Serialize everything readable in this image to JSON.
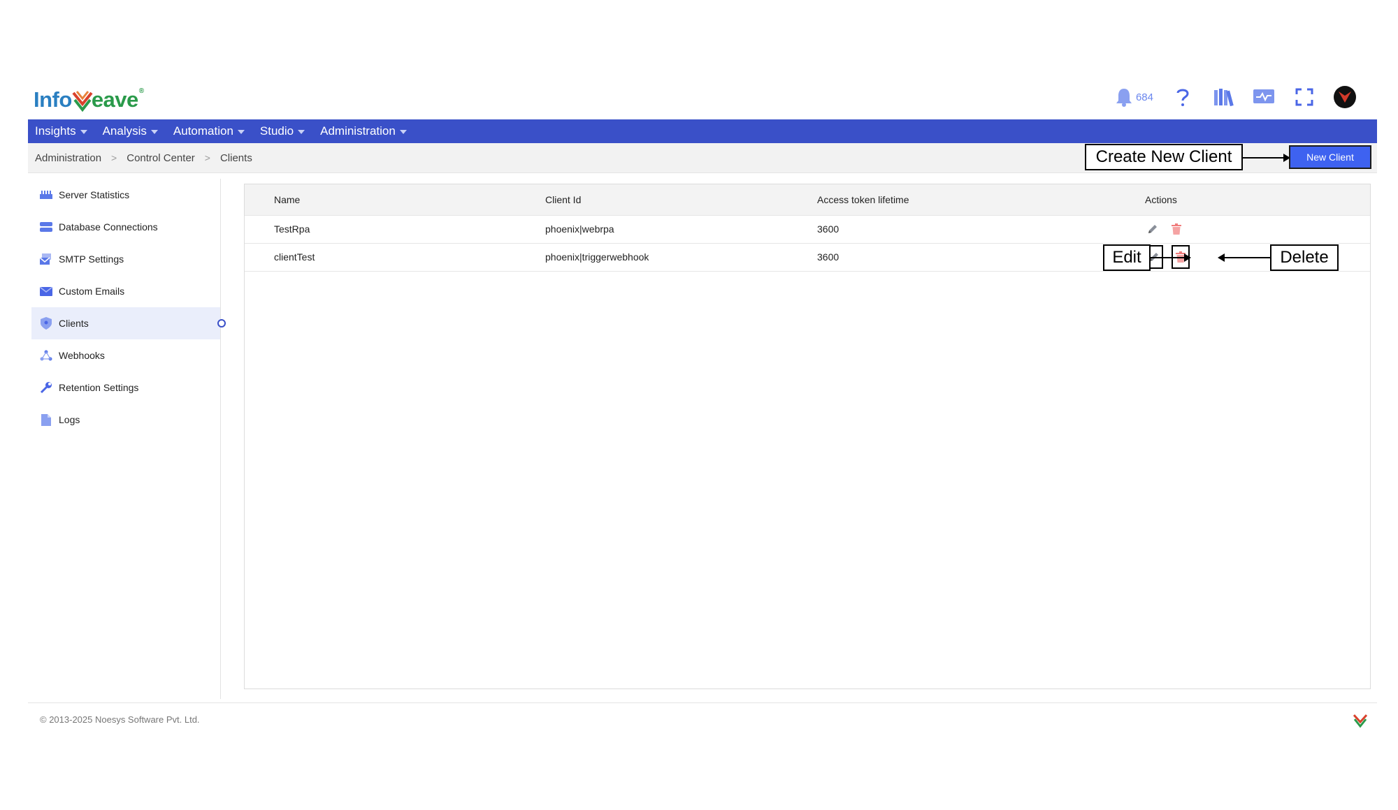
{
  "brand": {
    "logo_text_left": "Info",
    "logo_text_right": "eave",
    "logo_reg": "®"
  },
  "header": {
    "notification_count": "684"
  },
  "menu": [
    {
      "label": "Insights"
    },
    {
      "label": "Analysis"
    },
    {
      "label": "Automation"
    },
    {
      "label": "Studio"
    },
    {
      "label": "Administration"
    }
  ],
  "breadcrumb": [
    "Administration",
    "Control Center",
    "Clients"
  ],
  "new_client_button": "New Client",
  "annotations": {
    "create": "Create New Client",
    "edit": "Edit",
    "delete": "Delete"
  },
  "sidebar": {
    "items": [
      {
        "label": "Server Statistics",
        "icon": "server-icon"
      },
      {
        "label": "Database Connections",
        "icon": "database-icon"
      },
      {
        "label": "SMTP Settings",
        "icon": "mail-settings-icon"
      },
      {
        "label": "Custom Emails",
        "icon": "envelope-icon"
      },
      {
        "label": "Clients",
        "icon": "shield-icon",
        "active": true
      },
      {
        "label": "Webhooks",
        "icon": "webhook-icon"
      },
      {
        "label": "Retention Settings",
        "icon": "wrench-icon"
      },
      {
        "label": "Logs",
        "icon": "file-icon"
      }
    ]
  },
  "table": {
    "headers": [
      "Name",
      "Client Id",
      "Access token lifetime",
      "Actions"
    ],
    "rows": [
      {
        "name": "TestRpa",
        "client_id": "phoenix|webrpa",
        "lifetime": "3600"
      },
      {
        "name": "clientTest",
        "client_id": "phoenix|triggerwebhook",
        "lifetime": "3600"
      }
    ]
  },
  "footer": {
    "copyright": "© 2013-2025 Noesys Software Pvt. Ltd."
  },
  "colors": {
    "primary": "#3a50c8",
    "button": "#3e62f0",
    "delete": "#f07c7c"
  }
}
